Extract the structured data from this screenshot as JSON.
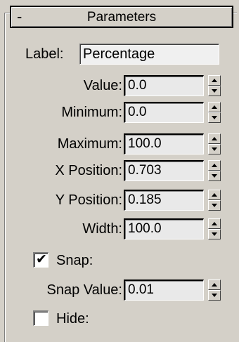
{
  "rollout": {
    "collapse_glyph": "-",
    "title": "Parameters"
  },
  "label_row": {
    "label": "Label:",
    "value": "Percentage"
  },
  "fields": [
    {
      "label": "Value:",
      "value": "0.0"
    },
    {
      "label": "Minimum:",
      "value": "0.0"
    },
    {
      "label": "Maximum:",
      "value": "100.0"
    },
    {
      "label": "X Position:",
      "value": "0.703"
    },
    {
      "label": "Y Position:",
      "value": "0.185"
    },
    {
      "label": "Width:",
      "value": "100.0"
    }
  ],
  "snap": {
    "label": "Snap:",
    "checked": true,
    "checkmark": "✔"
  },
  "snap_value": {
    "label": "Snap Value:",
    "value": "0.01"
  },
  "hide": {
    "label": "Hide:",
    "checked": false
  },
  "icons": {
    "spinner_up": "triangle-up",
    "spinner_down": "triangle-down"
  }
}
